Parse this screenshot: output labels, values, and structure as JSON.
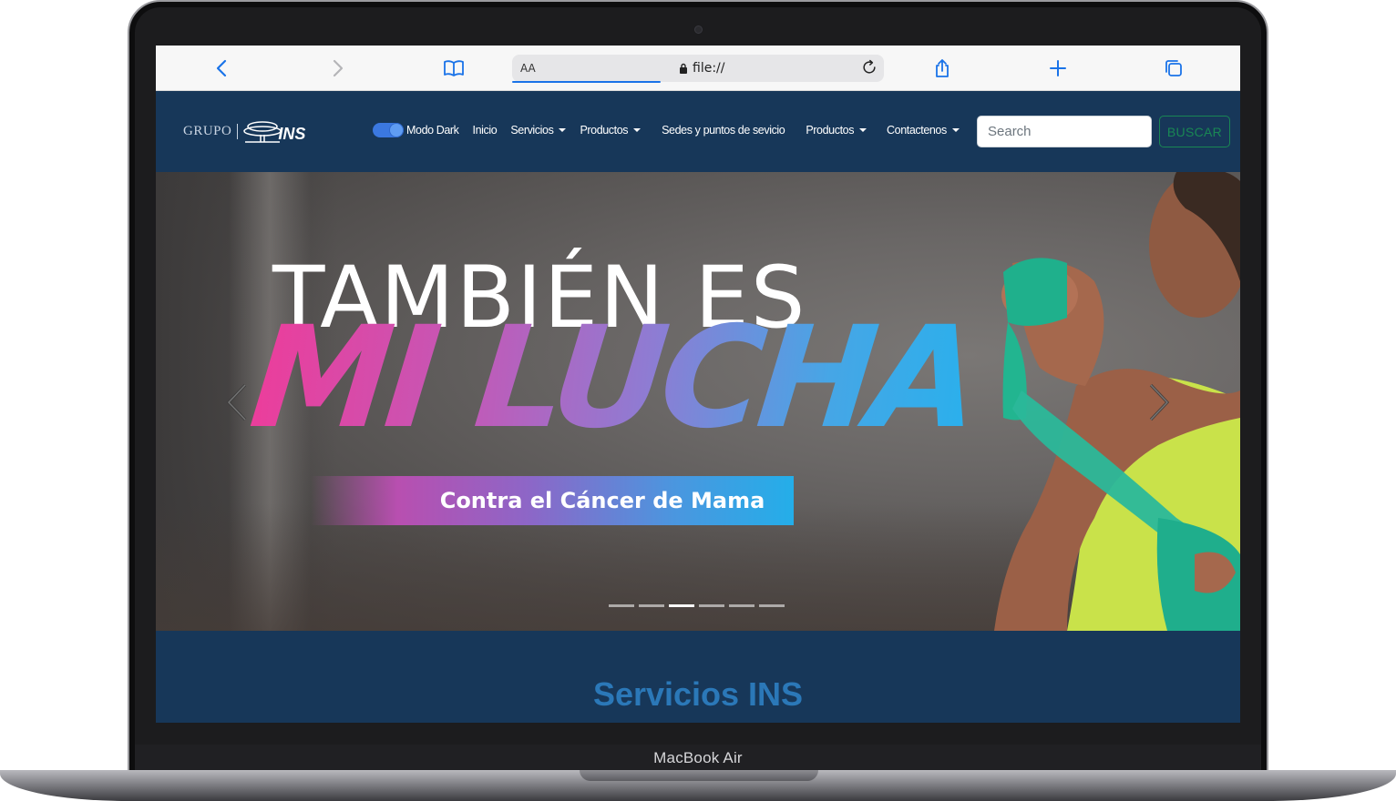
{
  "device": {
    "label": "MacBook Air"
  },
  "browser": {
    "aa_label": "AA",
    "url": "file://"
  },
  "navbar": {
    "brand": {
      "grupo": "GRUPO",
      "ins": "INS"
    },
    "dark_mode_label": "Modo Dark",
    "dark_mode_on": true,
    "items": [
      {
        "label": "Inicio",
        "dropdown": false
      },
      {
        "label": "Servicios",
        "dropdown": true
      },
      {
        "label": "Productos",
        "dropdown": true
      },
      {
        "label": "Sedes y puntos de sevicio",
        "dropdown": false
      },
      {
        "label": "Productos",
        "dropdown": true
      },
      {
        "label": "Contactenos",
        "dropdown": true
      }
    ],
    "search_placeholder": "Search",
    "search_button": "BUSCAR"
  },
  "hero": {
    "line1": "TAMBIÉN ES",
    "line2": "MI LUCHA",
    "banner": "Contra el Cáncer de Mama",
    "slides_total": 6,
    "active_slide": 3
  },
  "services": {
    "title": "Servicios INS"
  },
  "colors": {
    "navbar_bg": "#173759",
    "toggle": "#3b78e0",
    "search_button": "#198754",
    "services_title": "#2b78b8",
    "hero_pink": "#ec3d9b",
    "hero_blue": "#2ab0ec"
  }
}
